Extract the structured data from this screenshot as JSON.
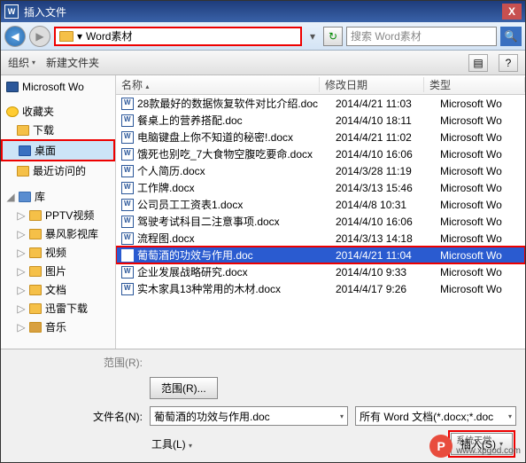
{
  "titlebar": {
    "icon_letter": "W",
    "title": "插入文件",
    "close": "X"
  },
  "nav": {
    "back": "◀",
    "fwd": "▶",
    "path_prefix": "▾",
    "path_text": "Word素材",
    "dropdown": "▾",
    "refresh": "↻",
    "search_placeholder": "搜索 Word素材",
    "search_icon": "🔍"
  },
  "toolbar": {
    "organize": "组织",
    "organize_caret": "▾",
    "newfolder": "新建文件夹",
    "view_icon": "▤",
    "help_icon": "?"
  },
  "sidebar": {
    "word_item": "Microsoft Wo",
    "favorites": "收藏夹",
    "downloads": "下载",
    "desktop": "桌面",
    "recent": "最近访问的",
    "libraries": "库",
    "pptv": "PPTV视频",
    "baofeng": "暴风影视库",
    "video": "视频",
    "pictures": "图片",
    "documents": "文档",
    "xunlei": "迅雷下载",
    "music": "音乐",
    "tree_collapsed": "▷",
    "tree_expanded": "◢"
  },
  "columns": {
    "name": "名称",
    "date": "修改日期",
    "type": "类型",
    "name_caret": "▴"
  },
  "files": [
    {
      "name": "28款最好的数据恢复软件对比介绍.doc",
      "date": "2014/4/21 11:03",
      "type": "Microsoft Wo"
    },
    {
      "name": "餐桌上的营养搭配.doc",
      "date": "2014/4/10 18:11",
      "type": "Microsoft Wo"
    },
    {
      "name": "电脑键盘上你不知道的秘密!.docx",
      "date": "2014/4/21 11:02",
      "type": "Microsoft Wo"
    },
    {
      "name": "饿死也别吃_7大食物空腹吃要命.docx",
      "date": "2014/4/10 16:06",
      "type": "Microsoft Wo"
    },
    {
      "name": "个人简历.docx",
      "date": "2014/3/28 11:19",
      "type": "Microsoft Wo"
    },
    {
      "name": "工作牌.docx",
      "date": "2014/3/13 15:46",
      "type": "Microsoft Wo"
    },
    {
      "name": "公司员工工资表1.docx",
      "date": "2014/4/8 10:31",
      "type": "Microsoft Wo"
    },
    {
      "name": "驾驶考试科目二注意事项.docx",
      "date": "2014/4/10 16:06",
      "type": "Microsoft Wo"
    },
    {
      "name": "流程图.docx",
      "date": "2014/3/13 14:18",
      "type": "Microsoft Wo"
    },
    {
      "name": "葡萄酒的功效与作用.doc",
      "date": "2014/4/21 11:04",
      "type": "Microsoft Wo"
    },
    {
      "name": "企业发展战略研究.docx",
      "date": "2014/4/10 9:33",
      "type": "Microsoft Wo"
    },
    {
      "name": "实木家具13种常用的木材.docx",
      "date": "2014/4/17 9:26",
      "type": "Microsoft Wo"
    }
  ],
  "selected_file_index": 9,
  "bottom": {
    "range_label": "范围(R):",
    "range_button": "范围(R)...",
    "filename_label": "文件名(N):",
    "filename_value": "葡萄酒的功效与作用.doc",
    "filter_value": "所有 Word 文档(*.docx;*.doc",
    "tools_label": "工具(L)",
    "tools_caret": "▾",
    "insert_label": "插入(S)",
    "insert_caret": "▾"
  },
  "watermark": {
    "badge": "P",
    "line1": "系统天堂",
    "line2": "www.xpgod.com"
  }
}
